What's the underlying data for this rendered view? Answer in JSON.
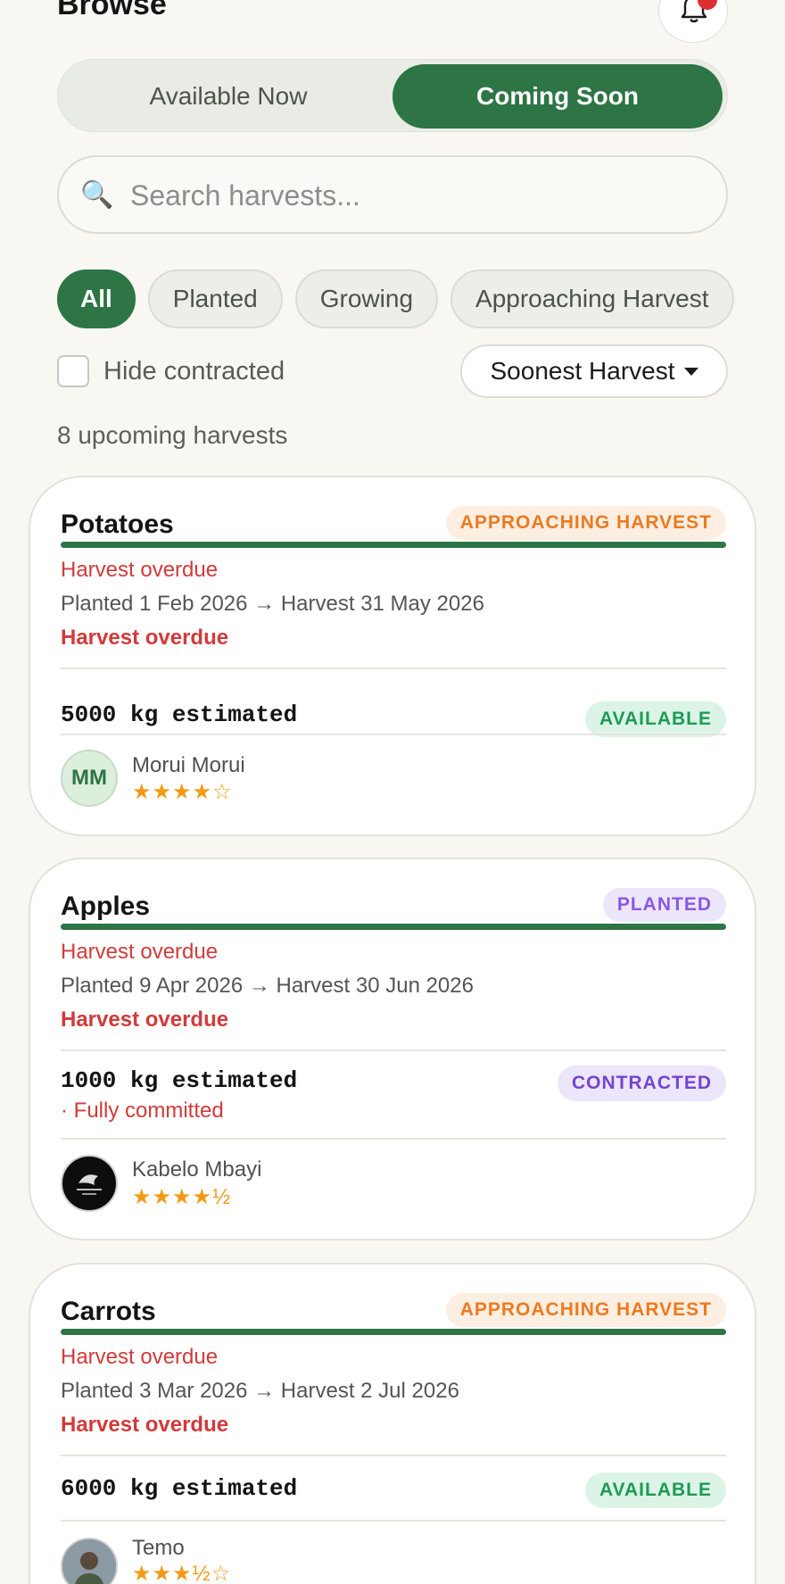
{
  "header": {
    "title": "Browse",
    "bell_icon": "bell-icon"
  },
  "tabs": {
    "available": "Available Now",
    "coming": "Coming Soon"
  },
  "search": {
    "placeholder": "Search harvests...",
    "icon": "search-icon"
  },
  "filters": [
    "All",
    "Planted",
    "Growing",
    "Approaching Harvest"
  ],
  "hide_contracted": "Hide contracted",
  "sort": {
    "label": "Soonest Harvest"
  },
  "count_text": "8 upcoming harvests",
  "colors": {
    "brand": "#2d7544",
    "danger": "#d23a3a",
    "star": "#f29a16",
    "accent_orange": "#ec7a1f",
    "accent_purple": "#8a57e4"
  },
  "cards": [
    {
      "crop": "Potatoes",
      "stage": "APPROACHING HARVEST",
      "overdue_note": "Harvest overdue",
      "dates": "Planted 1 Feb 2026 → Harvest 31 May 2026",
      "overdue_bold": "Harvest overdue",
      "quantity": "5000 kg estimated",
      "status": "AVAILABLE",
      "farmer": {
        "initials": "MM",
        "name": "Morui Morui",
        "stars": "★★★★☆"
      }
    },
    {
      "crop": "Apples",
      "stage": "PLANTED",
      "overdue_note": "Harvest overdue",
      "dates": "Planted 9 Apr 2026 → Harvest 30 Jun 2026",
      "overdue_bold": "Harvest overdue",
      "quantity": "1000 kg estimated",
      "commit_note": "· Fully committed",
      "status": "CONTRACTED",
      "farmer": {
        "name": "Kabelo Mbayi",
        "stars": "★★★★½"
      }
    },
    {
      "crop": "Carrots",
      "stage": "APPROACHING HARVEST",
      "overdue_note": "Harvest overdue",
      "dates": "Planted 3 Mar 2026 → Harvest 2 Jul 2026",
      "overdue_bold": "Harvest overdue",
      "quantity": "6000 kg estimated",
      "status": "AVAILABLE",
      "farmer": {
        "name": "Temo",
        "stars": "★★★½☆"
      }
    }
  ]
}
